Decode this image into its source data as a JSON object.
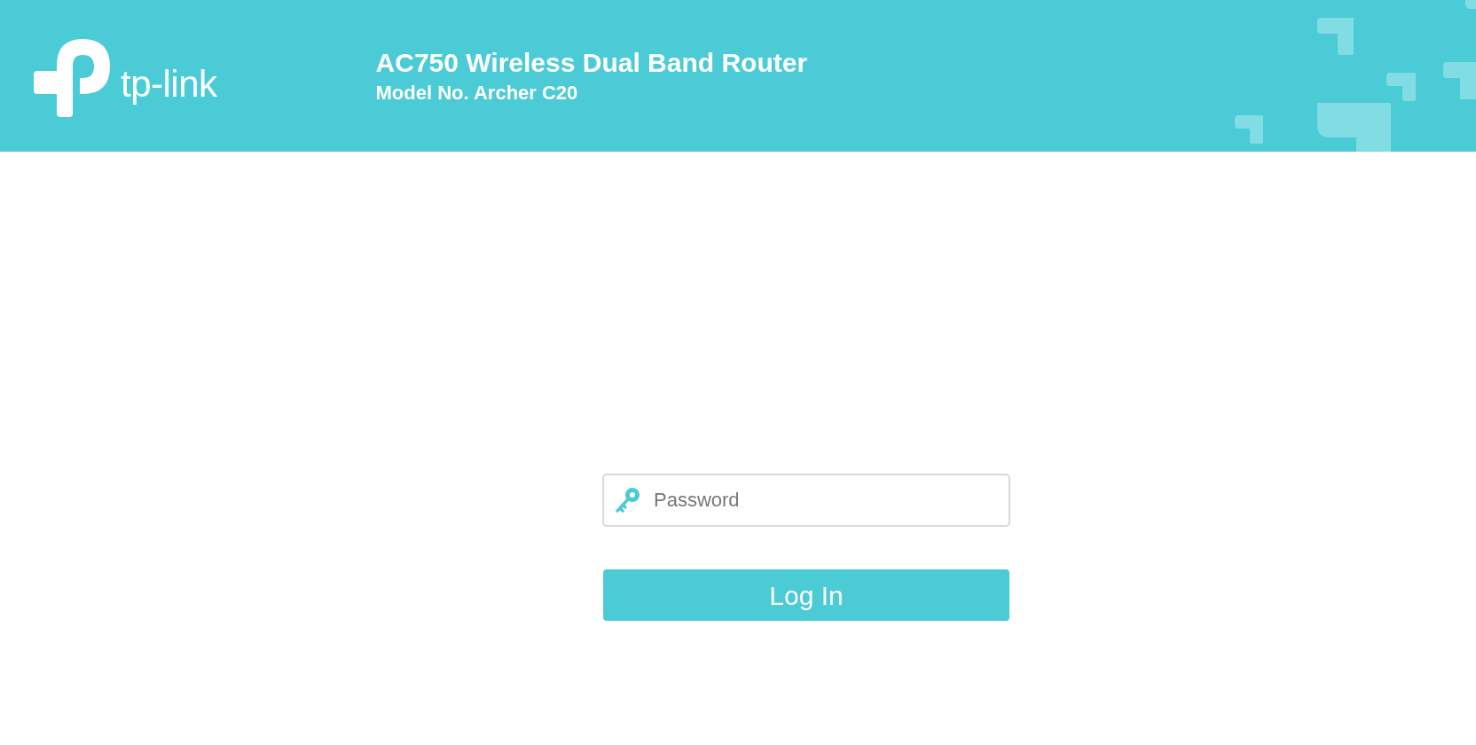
{
  "header": {
    "logo_text": "tp-link",
    "title": "AC750 Wireless Dual Band Router",
    "model": "Model No. Archer C20"
  },
  "login": {
    "password_placeholder": "Password",
    "button": "Log In"
  }
}
